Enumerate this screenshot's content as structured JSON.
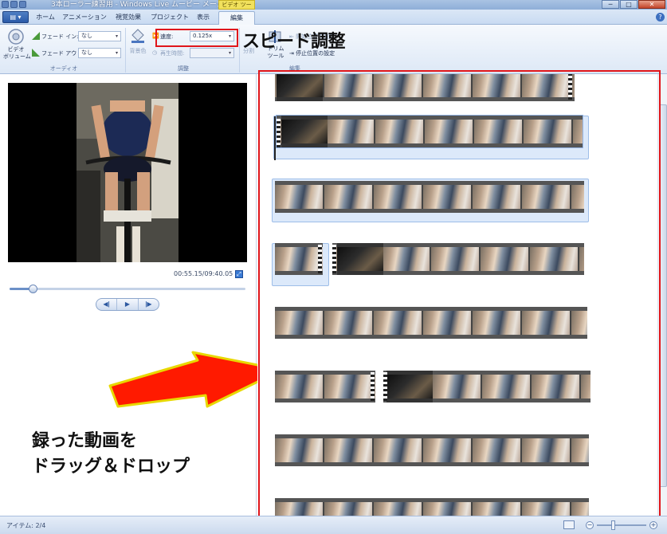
{
  "window": {
    "title": "3本ローラー練習用 - Windows Live ムービー メーカー",
    "context_tab": "ビデオ ツール",
    "controls": [
      "─",
      "□",
      "✕"
    ]
  },
  "tabs": [
    "ホーム",
    "アニメーション",
    "視覚効果",
    "プロジェクト",
    "表示",
    "編集"
  ],
  "active_tab": "編集",
  "ribbon": {
    "audio": {
      "video_volume": "ビデオ\nボリューム",
      "fade_in_label": "フェード イン:",
      "fade_in_value": "なし",
      "fade_out_label": "フェード アウト:",
      "fade_out_value": "なし",
      "group_label": "オーディオ"
    },
    "adjust": {
      "background_color": "背景色",
      "speed_label": "速度:",
      "speed_value": "0.125x",
      "duration_label": "再生時間:",
      "duration_value": "",
      "group_label": "調整"
    },
    "edit": {
      "split": "分割",
      "trim_tool": "トリム\nツール",
      "set_start": "開始位置の設定",
      "set_end": "停止位置の設定",
      "group_label": "編集"
    }
  },
  "callouts": {
    "speed": "スピード調整",
    "drag_drop_line1": "録った動画を",
    "drag_drop_line2": "ドラッグ＆ドロップ"
  },
  "player": {
    "timecode": "00:55.15/09:40.05",
    "seek_fraction": 0.098,
    "buttons": [
      "◀ǀ",
      "▶",
      "ǀ▶"
    ]
  },
  "status": {
    "items": "アイテム: 2/4"
  },
  "colors": {
    "highlight_red": "#e0161b",
    "arrow_red": "#ff1a00",
    "arrow_outline": "#e8d800",
    "ribbon_blue": "#dde8f6"
  }
}
